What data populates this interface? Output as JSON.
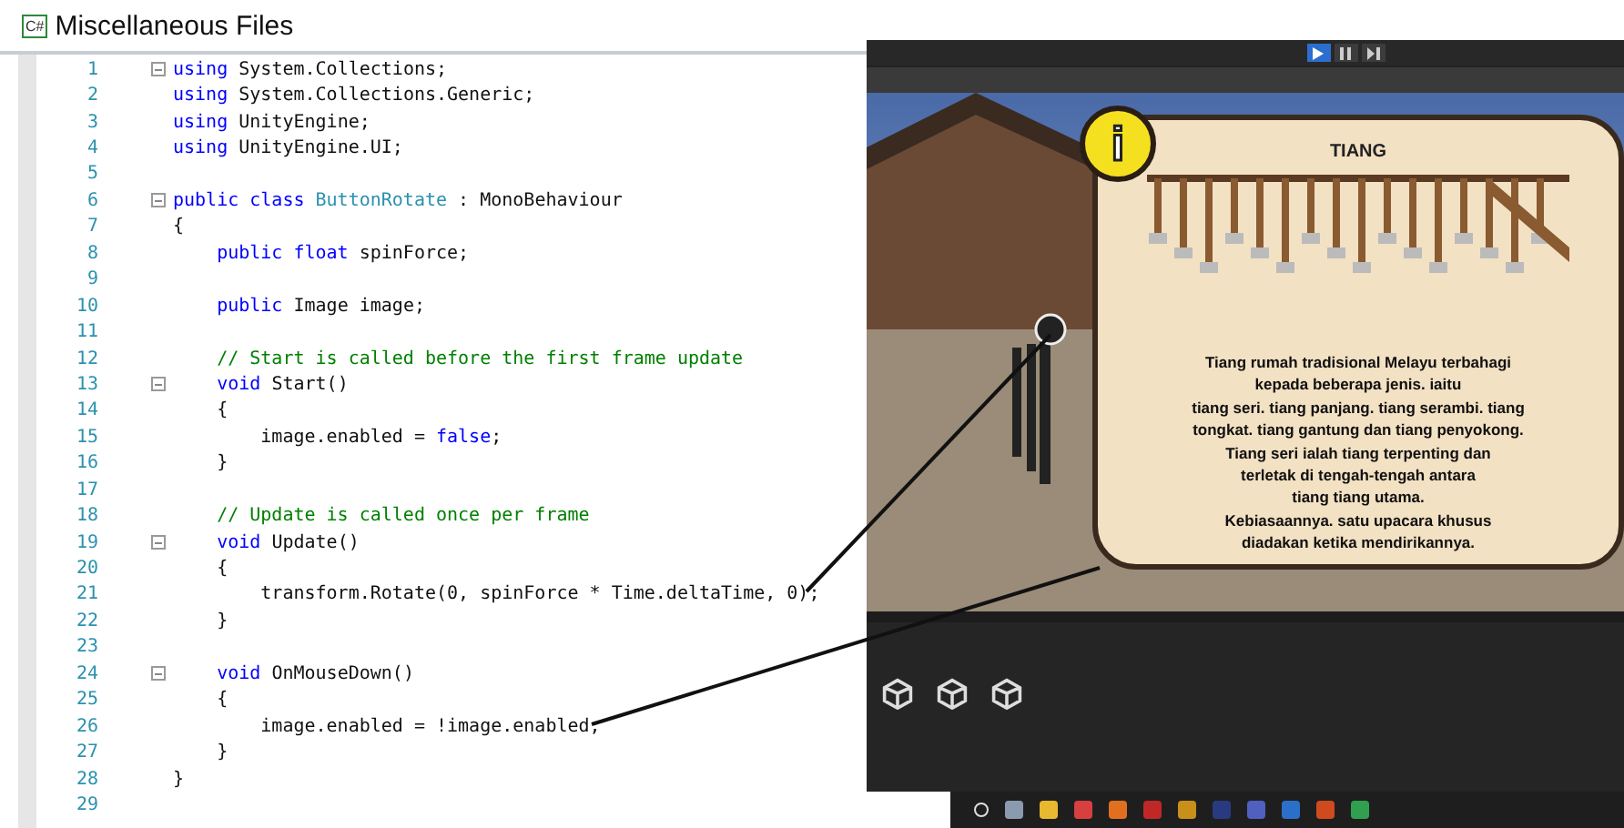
{
  "editor": {
    "title": "Miscellaneous Files",
    "file_badge": "C#",
    "lines": [
      {
        "number": "1",
        "fold": true,
        "tokens": [
          {
            "kind": "kw",
            "t": "using"
          },
          {
            "kind": "plain",
            "t": " System.Collections;"
          }
        ]
      },
      {
        "number": "2",
        "fold": false,
        "tokens": [
          {
            "kind": "kw",
            "t": "using"
          },
          {
            "kind": "plain",
            "t": " System.Collections.Generic;"
          }
        ]
      },
      {
        "number": "3",
        "fold": false,
        "tokens": [
          {
            "kind": "kw",
            "t": "using"
          },
          {
            "kind": "plain",
            "t": " UnityEngine;"
          }
        ]
      },
      {
        "number": "4",
        "fold": false,
        "tokens": [
          {
            "kind": "kw",
            "t": "using"
          },
          {
            "kind": "plain",
            "t": " UnityEngine.UI;"
          }
        ]
      },
      {
        "number": "5",
        "fold": false
      },
      {
        "number": "6",
        "fold": true,
        "tokens": [
          {
            "kind": "kw",
            "t": "public class"
          },
          {
            "kind": "type",
            "t": " ButtonRotate"
          },
          {
            "kind": "plain",
            "t": " : MonoBehaviour"
          }
        ]
      },
      {
        "number": "7",
        "fold": false,
        "tokens": [
          {
            "kind": "plain",
            "t": "{"
          }
        ]
      },
      {
        "number": "8",
        "fold": false,
        "tokens": [
          {
            "kind": "kw",
            "t": "    public float"
          },
          {
            "kind": "plain",
            "t": " spinForce;"
          }
        ]
      },
      {
        "number": "9",
        "fold": false
      },
      {
        "number": "10",
        "fold": false,
        "tokens": [
          {
            "kind": "kw",
            "t": "    public"
          },
          {
            "kind": "plain",
            "t": " Image image;"
          }
        ]
      },
      {
        "number": "11",
        "fold": false
      },
      {
        "number": "12",
        "fold": false,
        "tokens": [
          {
            "kind": "comment",
            "t": "    // Start is called before the first frame update"
          }
        ]
      },
      {
        "number": "13",
        "fold": true,
        "tokens": [
          {
            "kind": "kw",
            "t": "    void"
          },
          {
            "kind": "plain",
            "t": " Start()"
          }
        ]
      },
      {
        "number": "14",
        "fold": false,
        "tokens": [
          {
            "kind": "plain",
            "t": "    {"
          }
        ]
      },
      {
        "number": "15",
        "fold": false,
        "tokens": [
          {
            "kind": "plain",
            "t": "        image.enabled = "
          },
          {
            "kind": "kw",
            "t": "false"
          },
          {
            "kind": "plain",
            "t": ";"
          }
        ]
      },
      {
        "number": "16",
        "fold": false,
        "tokens": [
          {
            "kind": "plain",
            "t": "    }"
          }
        ]
      },
      {
        "number": "17",
        "fold": false
      },
      {
        "number": "18",
        "fold": false,
        "tokens": [
          {
            "kind": "comment",
            "t": "    // Update is called once per frame"
          }
        ]
      },
      {
        "number": "19",
        "fold": true,
        "tokens": [
          {
            "kind": "kw",
            "t": "    void"
          },
          {
            "kind": "plain",
            "t": " Update()"
          }
        ]
      },
      {
        "number": "20",
        "fold": false,
        "tokens": [
          {
            "kind": "plain",
            "t": "    {"
          }
        ]
      },
      {
        "number": "21",
        "fold": false,
        "tokens": [
          {
            "kind": "plain",
            "t": "        transform.Rotate(0, spinForce * Time.deltaTime, 0);"
          }
        ]
      },
      {
        "number": "22",
        "fold": false,
        "tokens": [
          {
            "kind": "plain",
            "t": "    }"
          }
        ]
      },
      {
        "number": "23",
        "fold": false
      },
      {
        "number": "24",
        "fold": true,
        "tokens": [
          {
            "kind": "kw",
            "t": "    void"
          },
          {
            "kind": "plain",
            "t": " OnMouseDown()"
          }
        ]
      },
      {
        "number": "25",
        "fold": false,
        "tokens": [
          {
            "kind": "plain",
            "t": "    {"
          }
        ]
      },
      {
        "number": "26",
        "fold": false,
        "tokens": [
          {
            "kind": "plain",
            "t": "        image.enabled = !image.enabled;"
          }
        ]
      },
      {
        "number": "27",
        "fold": false,
        "tokens": [
          {
            "kind": "plain",
            "t": "    }"
          }
        ]
      },
      {
        "number": "28",
        "fold": false,
        "tokens": [
          {
            "kind": "plain",
            "t": "}"
          }
        ]
      },
      {
        "number": "29",
        "fold": false
      }
    ]
  },
  "unity": {
    "playback_buttons": [
      {
        "kind": "play",
        "selected": true
      },
      {
        "kind": "pause",
        "selected": false
      },
      {
        "kind": "step",
        "selected": false
      }
    ],
    "info_panel": {
      "icon": "i",
      "title": "TIANG",
      "body_lines": [
        "Tiang rumah tradisional Melayu terbahagi",
        "kepada beberapa jenis. iaitu",
        "tiang seri. tiang panjang. tiang serambi. tiang",
        "tongkat. tiang gantung dan tiang penyokong.",
        "Tiang seri ialah tiang terpenting dan",
        "terletak di tengah-tengah antara",
        "tiang tiang utama.",
        "Kebiasaannya. satu upacara khusus",
        "diadakan ketika mendirikannya."
      ]
    },
    "taskbar_apps": [
      {
        "color": "#8a9bb0"
      },
      {
        "color": "#e8b830"
      },
      {
        "color": "#d84040"
      },
      {
        "color": "#e07020"
      },
      {
        "color": "#c02828"
      },
      {
        "color": "#c8901a"
      },
      {
        "color": "#2a3a80"
      },
      {
        "color": "#5060c0"
      },
      {
        "color": "#2a70c8"
      },
      {
        "color": "#d04a20"
      },
      {
        "color": "#30a050"
      }
    ]
  },
  "annotations": [
    {
      "kind": "line"
    },
    {
      "kind": "line"
    }
  ]
}
